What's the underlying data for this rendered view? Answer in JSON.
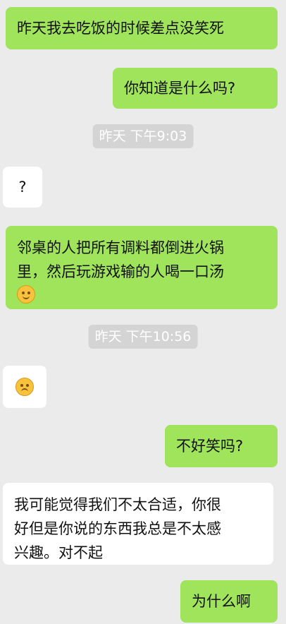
{
  "messages": [
    {
      "side": "sent",
      "text": "昨天我去吃饭的时候差点没笑死"
    },
    {
      "side": "sent",
      "text": "你知道是什么吗?"
    },
    {
      "timestamp": "昨天 下午9:03"
    },
    {
      "side": "recv",
      "text": "?"
    },
    {
      "side": "sent",
      "text_line1": "邻桌的人把所有调料都倒进火锅",
      "text_line2": "里，然后玩游戏输的人喝一口汤",
      "emoji": "grin-emoji"
    },
    {
      "timestamp": "昨天 下午10:56"
    },
    {
      "side": "recv",
      "emoji": "thinking-emoji"
    },
    {
      "side": "sent",
      "text": "不好笑吗?"
    },
    {
      "side": "recv",
      "text_line1": "我可能觉得我们不太合适，你很",
      "text_line2": "好但是你说的东西我总是不太感",
      "text_line3": "兴趣。对不起"
    },
    {
      "side": "sent",
      "text": "为什么啊"
    }
  ],
  "colors": {
    "background": "#ebebeb",
    "sent_bubble": "#9fe45a",
    "received_bubble": "#ffffff",
    "timestamp_bg": "#d4d4d4"
  }
}
